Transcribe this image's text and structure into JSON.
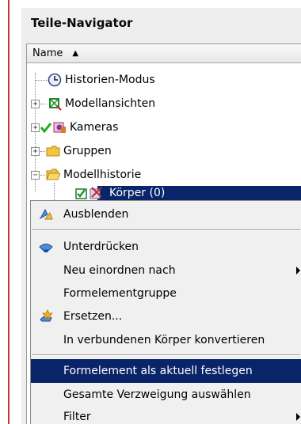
{
  "panel": {
    "title": "Teile-Navigator",
    "column_header": "Name",
    "sort_glyph": "▲"
  },
  "tree": {
    "items": [
      {
        "label": "Historien-Modus",
        "icon": "clock-icon"
      },
      {
        "label": "Modellansichten",
        "icon": "model-views-icon",
        "expander": "+"
      },
      {
        "label": "Kameras",
        "icon": "camera-icon",
        "expander": "+"
      },
      {
        "label": "Gruppen",
        "icon": "folder-icon",
        "expander": "+"
      },
      {
        "label": "Modellhistorie",
        "icon": "folder-open-icon",
        "expander": "−"
      }
    ],
    "selected_child": {
      "label": "Körper (0)",
      "icon": "body-icon"
    }
  },
  "context_menu": {
    "items": [
      {
        "label": "Ausblenden",
        "icon": "hide-icon"
      },
      {
        "label": "Unterdrücken",
        "icon": "suppress-icon"
      },
      {
        "label": "Neu einordnen nach",
        "submenu": true
      },
      {
        "label": "Formelementgruppe",
        "mnemonic": "F"
      },
      {
        "label": "Ersetzen...",
        "icon": "replace-icon",
        "mnemonic": "z"
      },
      {
        "label": "In verbundenen Körper konvertieren"
      },
      {
        "label": "Formelement als aktuell festlegen",
        "highlighted": true
      },
      {
        "label": "Gesamte Verzweigung auswählen"
      },
      {
        "label": "Filter",
        "submenu": true
      }
    ]
  },
  "colors": {
    "highlight": "#0a246a",
    "menu_bg": "#f0f0f0",
    "panel_bg": "#eeeeee",
    "accent_line": "#cc3333"
  }
}
